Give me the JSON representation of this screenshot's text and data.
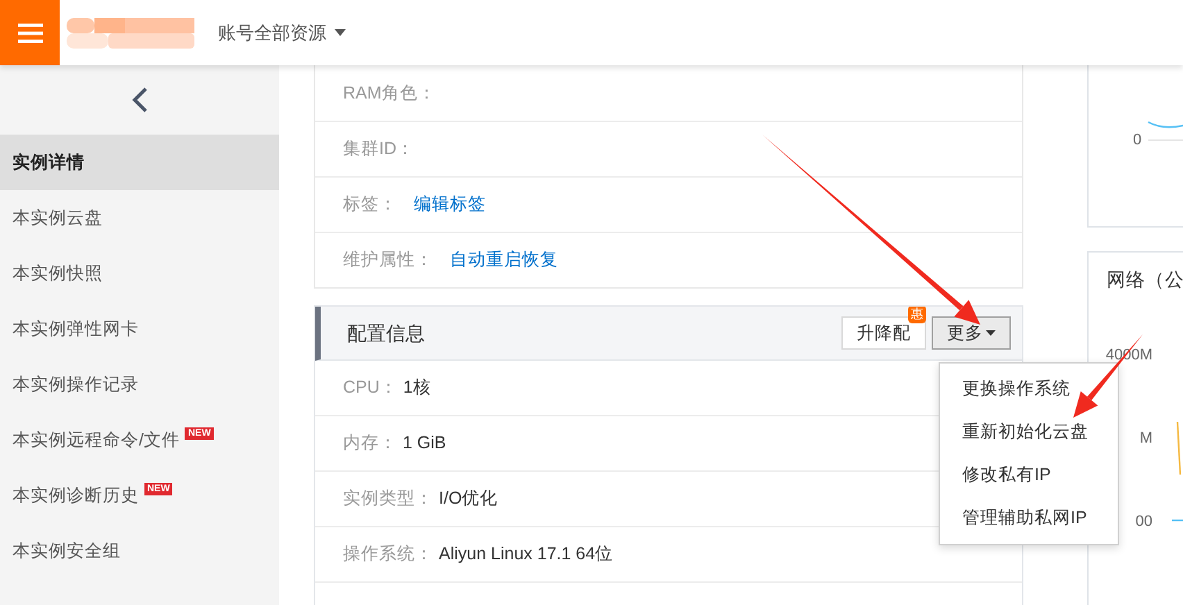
{
  "header": {
    "account_menu": "账号全部资源"
  },
  "sidebar": {
    "items": [
      {
        "label": "实例详情",
        "selected": true
      },
      {
        "label": "本实例云盘",
        "selected": false
      },
      {
        "label": "本实例快照",
        "selected": false
      },
      {
        "label": "本实例弹性网卡",
        "selected": false
      },
      {
        "label": "本实例操作记录",
        "selected": false
      },
      {
        "label": "本实例远程命令/文件",
        "selected": false,
        "badge": "NEW"
      },
      {
        "label": "本实例诊断历史",
        "selected": false,
        "badge": "NEW"
      },
      {
        "label": "本实例安全组",
        "selected": false
      }
    ]
  },
  "info_rows": [
    {
      "label": "RAM角色："
    },
    {
      "label": "集群ID："
    },
    {
      "label": "标签：",
      "link": "编辑标签"
    },
    {
      "label": "维护属性：",
      "link": "自动重启恢复"
    }
  ],
  "config": {
    "title": "配置信息",
    "buttons": [
      {
        "label": "升降配",
        "badge": "惠"
      },
      {
        "label": "更多",
        "dropdown": true
      }
    ],
    "rows": [
      {
        "label": "CPU：",
        "value": "1核"
      },
      {
        "label": "内存：",
        "value": "1 GiB"
      },
      {
        "label": "实例类型：",
        "value": "I/O优化"
      },
      {
        "label": "操作系统：",
        "value": "Aliyun Linux 17.1 64位"
      }
    ]
  },
  "dropdown_menu": [
    "更换操作系统",
    "重新初始化云盘",
    "修改私有IP",
    "管理辅助私网IP"
  ],
  "right_panel": {
    "top_chart_label": "0",
    "network_card": {
      "title": "网络（公",
      "axis_labels": [
        "4000M",
        "M",
        "00"
      ]
    }
  }
}
